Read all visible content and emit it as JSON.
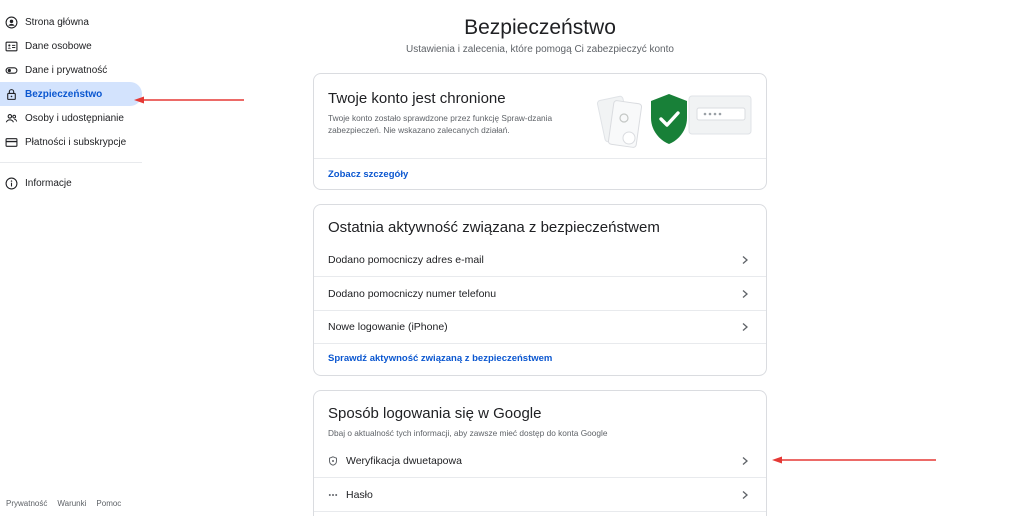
{
  "sidebar": {
    "items": [
      {
        "label": "Strona główna",
        "icon": "home-person-icon"
      },
      {
        "label": "Dane osobowe",
        "icon": "id-card-icon"
      },
      {
        "label": "Dane i prywatność",
        "icon": "toggle-icon"
      },
      {
        "label": "Bezpieczeństwo",
        "icon": "lock-icon",
        "active": true
      },
      {
        "label": "Osoby i udostępnianie",
        "icon": "people-icon"
      },
      {
        "label": "Płatności i subskrypcje",
        "icon": "credit-card-icon"
      }
    ],
    "secondary": [
      {
        "label": "Informacje",
        "icon": "info-icon"
      }
    ]
  },
  "footer": {
    "privacy": "Prywatność",
    "terms": "Warunki",
    "help": "Pomoc"
  },
  "header": {
    "title": "Bezpieczeństwo",
    "subtitle": "Ustawienia i zalecenia, które pomogą Ci zabezpieczyć konto"
  },
  "protected_card": {
    "title": "Twoje konto jest chronione",
    "description": "Twoje konto zostało sprawdzone przez funkcję Spraw-dzania zabezpieczeń. Nie wskazano zalecanych działań.",
    "link": "Zobacz szczegóły"
  },
  "activity_card": {
    "title": "Ostatnia aktywność związana z bezpieczeństwem",
    "rows": [
      "Dodano pomocniczy adres e-mail",
      "Dodano pomocniczy numer telefonu",
      "Nowe logowanie (iPhone)"
    ],
    "link": "Sprawdź aktywność związaną z bezpieczeństwem"
  },
  "signin_card": {
    "title": "Sposób logowania się w Google",
    "description": "Dbaj o aktualność tych informacji, aby zawsze mieć dostęp do konta Google",
    "rows": [
      {
        "label": "Weryfikacja dwuetapowa",
        "icon": "shield-clock-icon"
      },
      {
        "label": "Hasło",
        "icon": "password-dots-icon"
      }
    ]
  },
  "colors": {
    "accent": "#0b57d0",
    "active_bg": "#d3e3fd",
    "shield_green": "#188038",
    "annotation_red": "#e53935"
  }
}
